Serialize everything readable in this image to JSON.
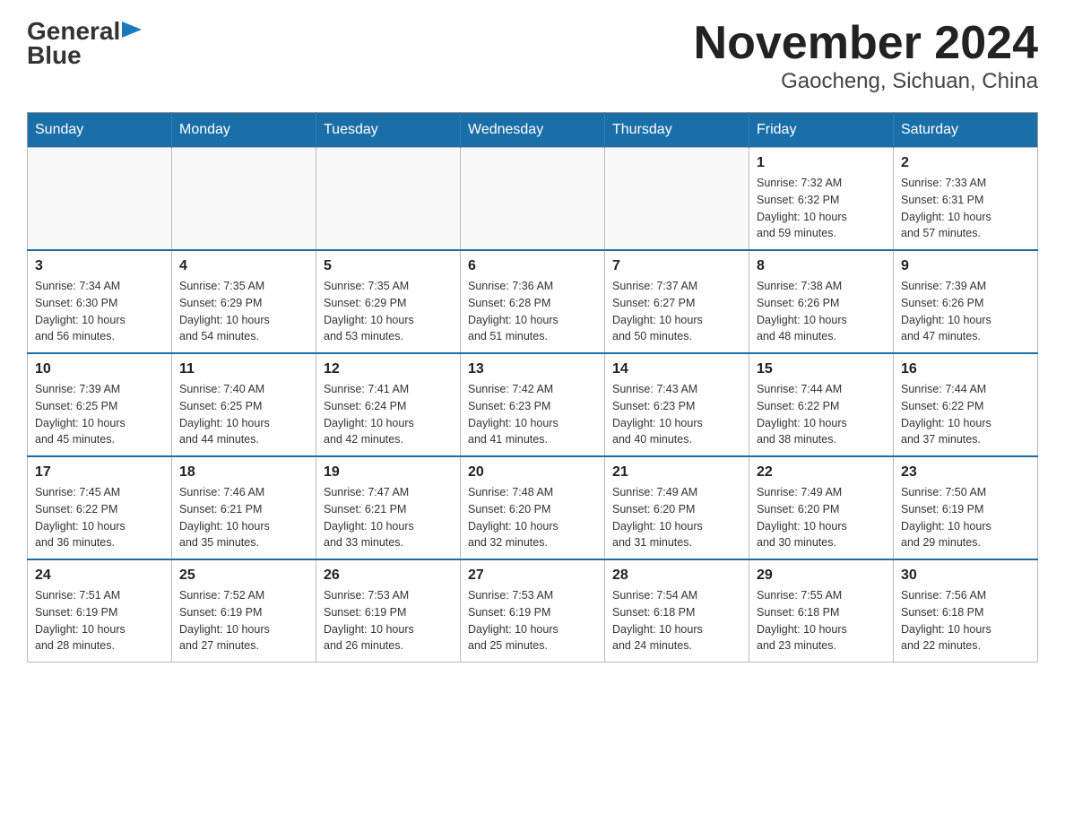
{
  "header": {
    "logo_general": "General",
    "logo_blue": "Blue",
    "title": "November 2024",
    "subtitle": "Gaocheng, Sichuan, China"
  },
  "calendar": {
    "days_of_week": [
      "Sunday",
      "Monday",
      "Tuesday",
      "Wednesday",
      "Thursday",
      "Friday",
      "Saturday"
    ],
    "weeks": [
      [
        {
          "day": "",
          "info": ""
        },
        {
          "day": "",
          "info": ""
        },
        {
          "day": "",
          "info": ""
        },
        {
          "day": "",
          "info": ""
        },
        {
          "day": "",
          "info": ""
        },
        {
          "day": "1",
          "info": "Sunrise: 7:32 AM\nSunset: 6:32 PM\nDaylight: 10 hours\nand 59 minutes."
        },
        {
          "day": "2",
          "info": "Sunrise: 7:33 AM\nSunset: 6:31 PM\nDaylight: 10 hours\nand 57 minutes."
        }
      ],
      [
        {
          "day": "3",
          "info": "Sunrise: 7:34 AM\nSunset: 6:30 PM\nDaylight: 10 hours\nand 56 minutes."
        },
        {
          "day": "4",
          "info": "Sunrise: 7:35 AM\nSunset: 6:29 PM\nDaylight: 10 hours\nand 54 minutes."
        },
        {
          "day": "5",
          "info": "Sunrise: 7:35 AM\nSunset: 6:29 PM\nDaylight: 10 hours\nand 53 minutes."
        },
        {
          "day": "6",
          "info": "Sunrise: 7:36 AM\nSunset: 6:28 PM\nDaylight: 10 hours\nand 51 minutes."
        },
        {
          "day": "7",
          "info": "Sunrise: 7:37 AM\nSunset: 6:27 PM\nDaylight: 10 hours\nand 50 minutes."
        },
        {
          "day": "8",
          "info": "Sunrise: 7:38 AM\nSunset: 6:26 PM\nDaylight: 10 hours\nand 48 minutes."
        },
        {
          "day": "9",
          "info": "Sunrise: 7:39 AM\nSunset: 6:26 PM\nDaylight: 10 hours\nand 47 minutes."
        }
      ],
      [
        {
          "day": "10",
          "info": "Sunrise: 7:39 AM\nSunset: 6:25 PM\nDaylight: 10 hours\nand 45 minutes."
        },
        {
          "day": "11",
          "info": "Sunrise: 7:40 AM\nSunset: 6:25 PM\nDaylight: 10 hours\nand 44 minutes."
        },
        {
          "day": "12",
          "info": "Sunrise: 7:41 AM\nSunset: 6:24 PM\nDaylight: 10 hours\nand 42 minutes."
        },
        {
          "day": "13",
          "info": "Sunrise: 7:42 AM\nSunset: 6:23 PM\nDaylight: 10 hours\nand 41 minutes."
        },
        {
          "day": "14",
          "info": "Sunrise: 7:43 AM\nSunset: 6:23 PM\nDaylight: 10 hours\nand 40 minutes."
        },
        {
          "day": "15",
          "info": "Sunrise: 7:44 AM\nSunset: 6:22 PM\nDaylight: 10 hours\nand 38 minutes."
        },
        {
          "day": "16",
          "info": "Sunrise: 7:44 AM\nSunset: 6:22 PM\nDaylight: 10 hours\nand 37 minutes."
        }
      ],
      [
        {
          "day": "17",
          "info": "Sunrise: 7:45 AM\nSunset: 6:22 PM\nDaylight: 10 hours\nand 36 minutes."
        },
        {
          "day": "18",
          "info": "Sunrise: 7:46 AM\nSunset: 6:21 PM\nDaylight: 10 hours\nand 35 minutes."
        },
        {
          "day": "19",
          "info": "Sunrise: 7:47 AM\nSunset: 6:21 PM\nDaylight: 10 hours\nand 33 minutes."
        },
        {
          "day": "20",
          "info": "Sunrise: 7:48 AM\nSunset: 6:20 PM\nDaylight: 10 hours\nand 32 minutes."
        },
        {
          "day": "21",
          "info": "Sunrise: 7:49 AM\nSunset: 6:20 PM\nDaylight: 10 hours\nand 31 minutes."
        },
        {
          "day": "22",
          "info": "Sunrise: 7:49 AM\nSunset: 6:20 PM\nDaylight: 10 hours\nand 30 minutes."
        },
        {
          "day": "23",
          "info": "Sunrise: 7:50 AM\nSunset: 6:19 PM\nDaylight: 10 hours\nand 29 minutes."
        }
      ],
      [
        {
          "day": "24",
          "info": "Sunrise: 7:51 AM\nSunset: 6:19 PM\nDaylight: 10 hours\nand 28 minutes."
        },
        {
          "day": "25",
          "info": "Sunrise: 7:52 AM\nSunset: 6:19 PM\nDaylight: 10 hours\nand 27 minutes."
        },
        {
          "day": "26",
          "info": "Sunrise: 7:53 AM\nSunset: 6:19 PM\nDaylight: 10 hours\nand 26 minutes."
        },
        {
          "day": "27",
          "info": "Sunrise: 7:53 AM\nSunset: 6:19 PM\nDaylight: 10 hours\nand 25 minutes."
        },
        {
          "day": "28",
          "info": "Sunrise: 7:54 AM\nSunset: 6:18 PM\nDaylight: 10 hours\nand 24 minutes."
        },
        {
          "day": "29",
          "info": "Sunrise: 7:55 AM\nSunset: 6:18 PM\nDaylight: 10 hours\nand 23 minutes."
        },
        {
          "day": "30",
          "info": "Sunrise: 7:56 AM\nSunset: 6:18 PM\nDaylight: 10 hours\nand 22 minutes."
        }
      ]
    ]
  }
}
